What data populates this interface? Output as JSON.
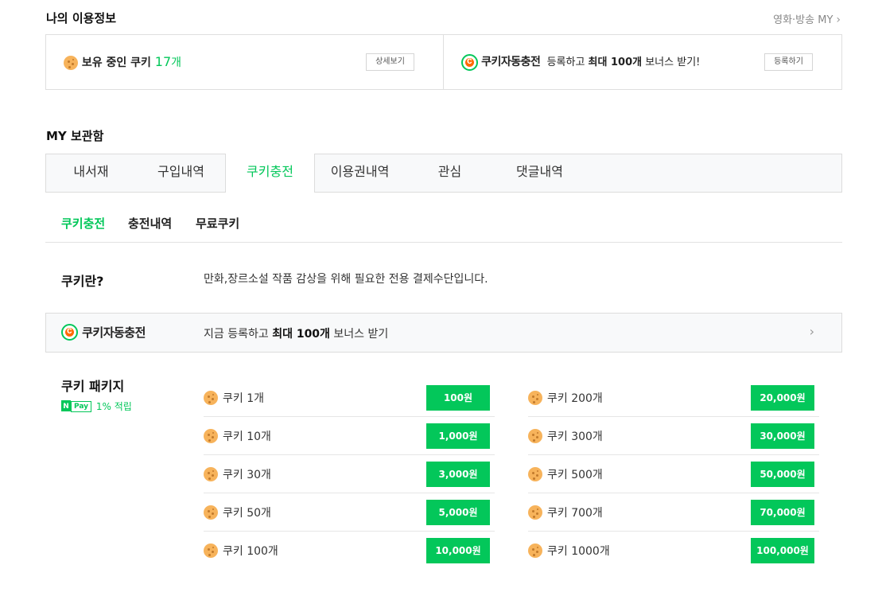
{
  "my_info": {
    "title": "나의 이용정보",
    "top_link": "영화·방송 MY",
    "cookie_prefix": "보유 중인 쿠키 ",
    "cookie_count": "17",
    "cookie_unit": "개",
    "detail_btn": "상세보기",
    "auto_logo_text": "쿠키자동충전",
    "auto_desc_1": "등록하고 ",
    "auto_desc_bold": "최대 100개",
    "auto_desc_2": " 보너스 받기!",
    "register_btn": "등록하기"
  },
  "box": {
    "title": "MY 보관함",
    "tabs": [
      {
        "label": "내서재"
      },
      {
        "label": "구입내역"
      },
      {
        "label": "쿠키충전"
      },
      {
        "label": "이용권내역"
      },
      {
        "label": "관심"
      },
      {
        "label": "댓글내역"
      }
    ],
    "active_tab": 2
  },
  "subtabs": [
    {
      "label": "쿠키충전"
    },
    {
      "label": "충전내역"
    },
    {
      "label": "무료쿠키"
    }
  ],
  "what_is": {
    "label": "쿠키란?",
    "desc": "만화,장르소설 작품 감상을 위해 필요한 전용 결제수단입니다."
  },
  "auto_banner": {
    "logo_text": "쿠키자동충전",
    "desc_1": "지금 등록하고 ",
    "desc_bold": "최대 100개",
    "desc_2": " 보너스 받기"
  },
  "package": {
    "label": "쿠키 패키지",
    "npay_n": "N",
    "npay_p": "Pay",
    "reward": "1% 적립",
    "left": [
      {
        "name": "쿠키 1개",
        "price": "100원"
      },
      {
        "name": "쿠키 10개",
        "price": "1,000원"
      },
      {
        "name": "쿠키 30개",
        "price": "3,000원"
      },
      {
        "name": "쿠키 50개",
        "price": "5,000원"
      },
      {
        "name": "쿠키 100개",
        "price": "10,000원"
      }
    ],
    "right": [
      {
        "name": "쿠키 200개",
        "price": "20,000원"
      },
      {
        "name": "쿠키 300개",
        "price": "30,000원"
      },
      {
        "name": "쿠키 500개",
        "price": "50,000원"
      },
      {
        "name": "쿠키 700개",
        "price": "70,000원"
      },
      {
        "name": "쿠키 1000개",
        "price": "100,000원"
      }
    ]
  },
  "colors": {
    "accent": "#03c75a",
    "cookie": "#f7b35b",
    "logo_orange": "#ff6a00"
  }
}
